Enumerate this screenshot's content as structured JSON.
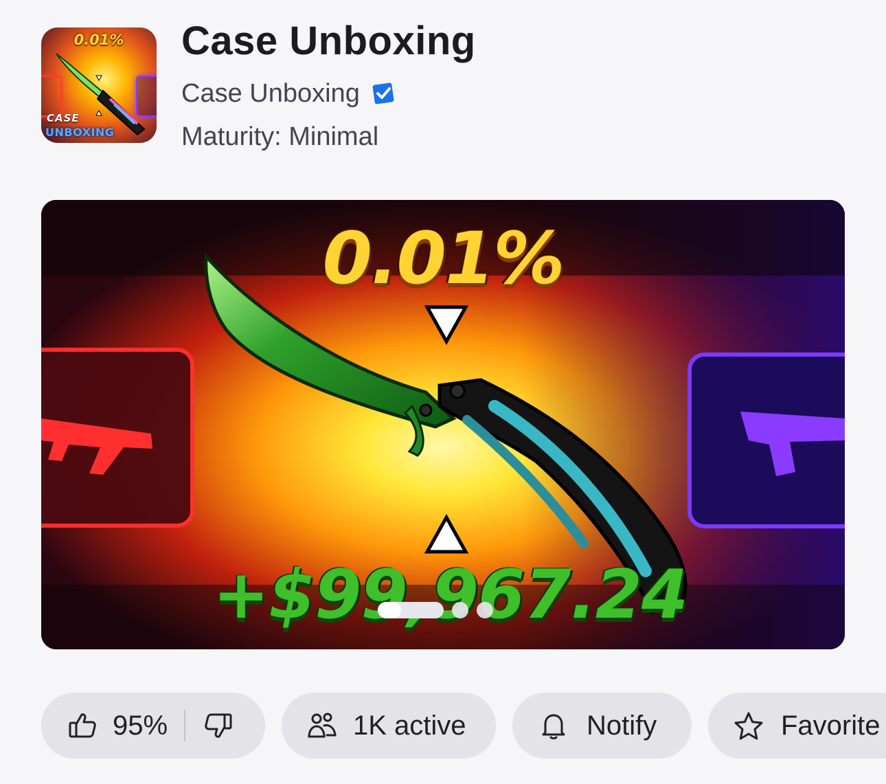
{
  "header": {
    "title": "Case Unboxing",
    "creator": "Case Unboxing",
    "maturity": "Maturity: Minimal",
    "icon": {
      "percent_text": "0.01%",
      "case_text": "CASE",
      "unboxing_text": "UNBOXING"
    }
  },
  "hero": {
    "percent_text": "0.01%",
    "amount_text": "+$99,967.24",
    "pager": {
      "count": 3,
      "active_index": 0
    }
  },
  "actions": {
    "rating_text": "95%",
    "active_text": "1K active",
    "notify_label": "Notify",
    "favorite_label": "Favorite"
  },
  "colors": {
    "background": "#f6f6f8",
    "chip": "#e3e3e8",
    "verified": "#1a73e8",
    "text_primary": "#1b1b20",
    "text_secondary": "#44444e"
  },
  "icons": {
    "verified": "verified-badge-icon",
    "like": "thumbs-up-icon",
    "dislike": "thumbs-down-icon",
    "active": "people-icon",
    "notify": "bell-icon",
    "favorite": "star-icon"
  }
}
